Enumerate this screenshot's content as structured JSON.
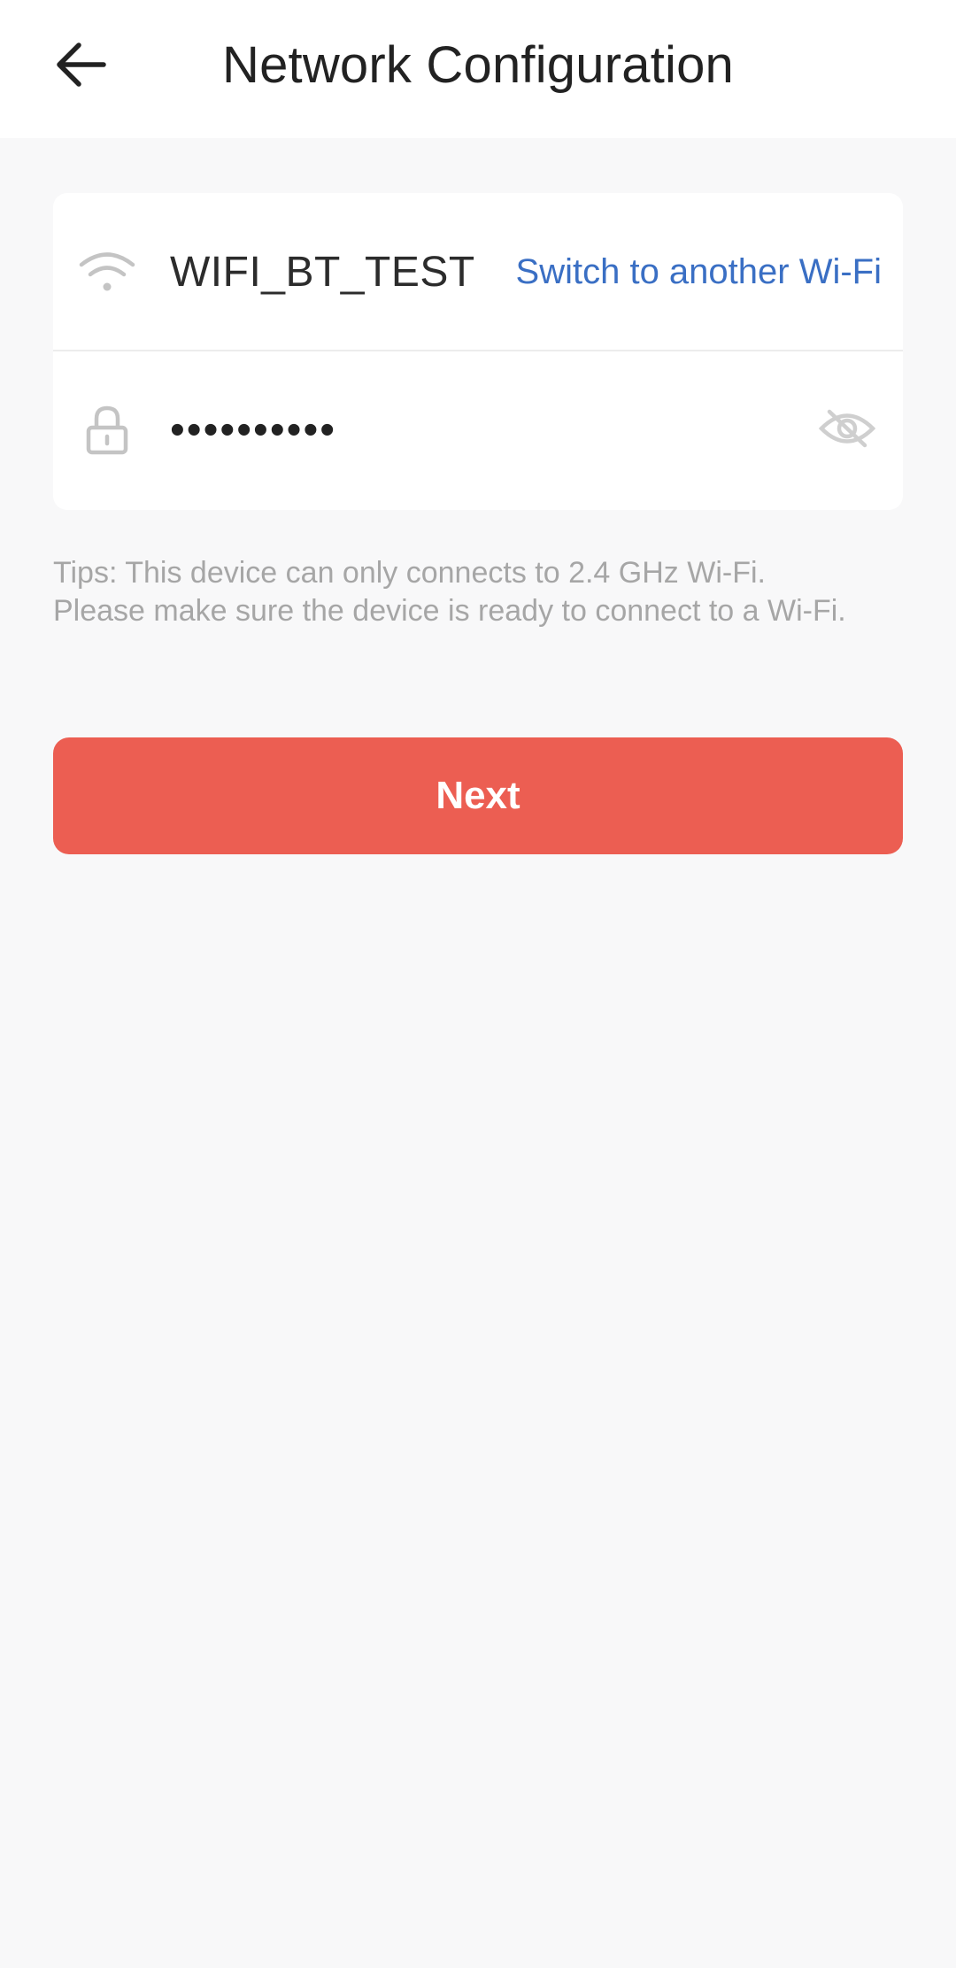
{
  "header": {
    "back_icon": "arrow-left-icon",
    "title": "Network Configuration"
  },
  "wifi": {
    "icon": "wifi-icon",
    "ssid": "WIFI_BT_TEST",
    "switch_label": "Switch to another Wi-Fi"
  },
  "password": {
    "icon": "lock-icon",
    "value": "••••••••••",
    "visibility_icon": "eye-slash-icon"
  },
  "tips": {
    "line1": "Tips: This device can only connects to 2.4 GHz Wi-Fi.",
    "line2": "Please make sure the device is ready to connect to a Wi-Fi."
  },
  "actions": {
    "next_label": "Next"
  },
  "colors": {
    "accent": "#ec5e52",
    "link": "#3a6fc4",
    "background": "#f8f8f9",
    "tip_text": "#a6a6a6"
  }
}
